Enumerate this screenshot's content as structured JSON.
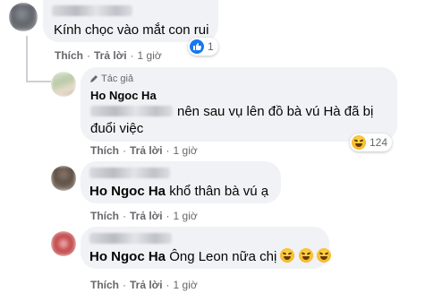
{
  "comments": [
    {
      "text": "Kính chọc vào mắt con rui",
      "reaction_count": "1",
      "reaction_type": "like-icon",
      "actions": {
        "like": "Thích",
        "reply": "Trả lời",
        "time": "1 giờ"
      }
    },
    {
      "author_badge": "Tác giả",
      "author": "Ho Ngoc Ha",
      "text": "nên sau vụ lên đồ bà vú Hà đã bị đuổi việc",
      "reaction_count": "124",
      "reaction_type": "haha-icon",
      "actions": {
        "like": "Thích",
        "reply": "Trả lời",
        "time": "1 giờ"
      }
    },
    {
      "mention": "Ho Ngoc Ha",
      "text": "khổ thân bà vú ạ",
      "actions": {
        "like": "Thích",
        "reply": "Trả lời",
        "time": "1 giờ"
      }
    },
    {
      "mention": "Ho Ngoc Ha",
      "text": "Ông Leon nữa chị",
      "actions": {
        "like": "Thích",
        "reply": "Trả lời",
        "time": "1 giờ"
      }
    }
  ],
  "colors": {
    "bubble": "#f0f2f5",
    "secondary_text": "#65676b",
    "like_blue": "#1877f2"
  }
}
